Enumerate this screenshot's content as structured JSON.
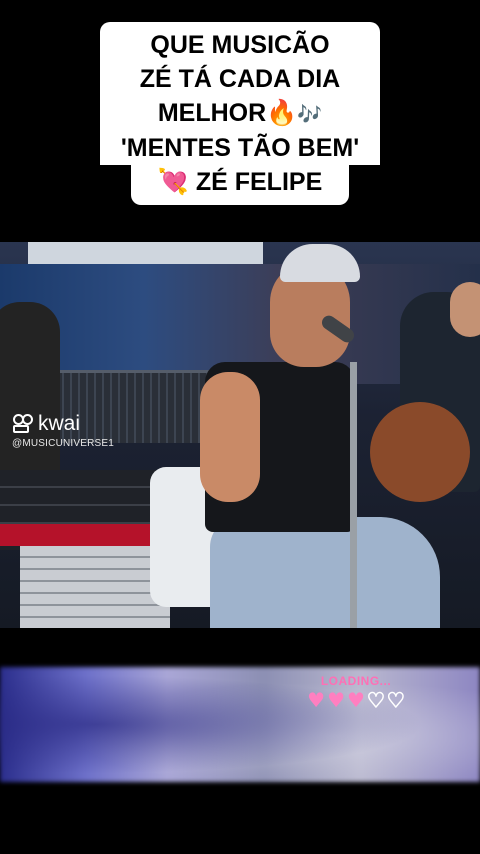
{
  "caption": {
    "lines": [
      "QUE MUSICÃO",
      "ZÉ TÁ CADA DIA",
      "MELHOR",
      "'MENTES TÃO BEM'",
      "ZÉ FELIPE"
    ],
    "fire_emoji": "🔥",
    "notes_emoji": "🎶",
    "heart_emoji": "💘"
  },
  "watermark": {
    "brand": "kwai",
    "handle": "@MUSICUNIVERSE1"
  },
  "loading": {
    "label": "LOADING...",
    "hearts": [
      "full",
      "full",
      "full",
      "empty",
      "empty"
    ],
    "heart_glyph": "♥"
  },
  "colors": {
    "background": "#000000",
    "caption_bg": "#ffffff",
    "loading_pink": "#ff6fb5"
  }
}
